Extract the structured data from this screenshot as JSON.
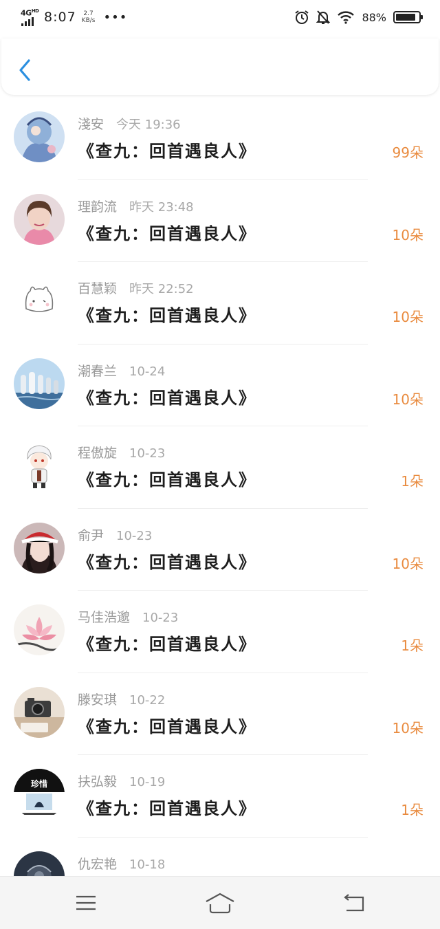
{
  "status_bar": {
    "network": "4G",
    "network_sup": "HD",
    "time": "8:07",
    "speed_value": "2.7",
    "speed_unit": "KB/s",
    "more": "•••",
    "battery_percent": "88%",
    "battery_level": 0.88,
    "icons": [
      "alarm-icon",
      "mute-bell-icon",
      "wifi-icon",
      "battery-icon"
    ]
  },
  "header": {
    "back_icon": "chevron-left-icon",
    "accent_color": "#2b8fe0"
  },
  "rows": [
    {
      "name": "淺安",
      "date": "今天 19:36",
      "title": "《查九：回首遇良人》",
      "count": "99朵",
      "avatar": "anime-blue"
    },
    {
      "name": "理韵流",
      "date": "昨天 23:48",
      "title": "《查九：回首遇良人》",
      "count": "10朵",
      "avatar": "woman-pink"
    },
    {
      "name": "百慧颖",
      "date": "昨天 22:52",
      "title": "《查九：回首遇良人》",
      "count": "10朵",
      "avatar": "bunny"
    },
    {
      "name": "潮春兰",
      "date": "10-24",
      "title": "《查九：回首遇良人》",
      "count": "10朵",
      "avatar": "city-sea"
    },
    {
      "name": "程傲旋",
      "date": "10-23",
      "title": "《查九：回首遇良人》",
      "count": "1朵",
      "avatar": "chibi-boy"
    },
    {
      "name": "俞尹",
      "date": "10-23",
      "title": "《查九：回首遇良人》",
      "count": "10朵",
      "avatar": "girl-hat"
    },
    {
      "name": "马佳浩邈",
      "date": "10-23",
      "title": "《查九：回首遇良人》",
      "count": "1朵",
      "avatar": "lotus"
    },
    {
      "name": "滕安琪",
      "date": "10-22",
      "title": "《查九：回首遇良人》",
      "count": "10朵",
      "avatar": "camera"
    },
    {
      "name": "扶弘毅",
      "date": "10-19",
      "title": "《查九：回首遇良人》",
      "count": "1朵",
      "avatar": "poster",
      "avatar_text": "珍惜"
    },
    {
      "name": "仇宏艳",
      "date": "10-18",
      "title": "",
      "count": "",
      "avatar": "dark"
    }
  ],
  "colors": {
    "count": "#e98b3f",
    "name": "#9a9a9a",
    "title": "#1e1e1e"
  },
  "navbar": {
    "items": [
      "menu-icon",
      "home-icon",
      "back-icon"
    ]
  }
}
